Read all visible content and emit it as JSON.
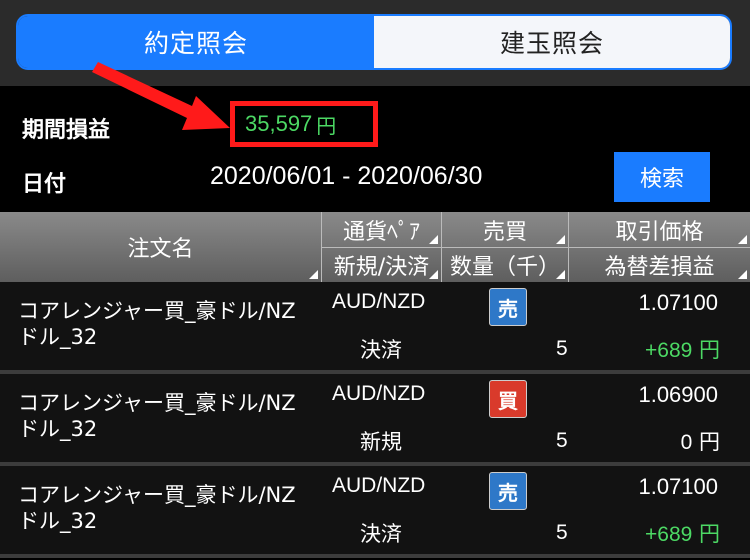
{
  "tabs": [
    {
      "label": "約定照会",
      "active": true
    },
    {
      "label": "建玉照会",
      "active": false
    }
  ],
  "summary": {
    "period_pl_label": "期間損益",
    "period_pl_value": "35,597",
    "period_pl_unit": "円",
    "date_label": "日付",
    "date_range": "2020/06/01 - 2020/06/30",
    "search_label": "検索"
  },
  "table": {
    "headers": {
      "order_name": "注文名",
      "pair": "通貨ﾍﾟｱ",
      "side": "売買",
      "price": "取引価格",
      "kind": "新規/決済",
      "qty": "数量（千）",
      "pl": "為替差損益"
    },
    "rows": [
      {
        "order_name": "コアレンジャー買_豪ドル/NZドル_32",
        "pair": "AUD/NZD",
        "side": "売",
        "kind": "決済",
        "qty": "5",
        "price": "1.07100",
        "pl": "+689",
        "pl_unit": "円"
      },
      {
        "order_name": "コアレンジャー買_豪ドル/NZドル_32",
        "pair": "AUD/NZD",
        "side": "買",
        "kind": "新規",
        "qty": "5",
        "price": "1.06900",
        "pl": "0",
        "pl_unit": "円"
      },
      {
        "order_name": "コアレンジャー買_豪ドル/NZドル_32",
        "pair": "AUD/NZD",
        "side": "売",
        "kind": "決済",
        "qty": "5",
        "price": "1.07100",
        "pl": "+689",
        "pl_unit": "円"
      }
    ]
  },
  "colors": {
    "accent": "#1a7cff",
    "profit": "#4cd964",
    "sell_badge": "#2e78c8",
    "buy_badge": "#d93a2b",
    "highlight": "#ff1a1a"
  }
}
